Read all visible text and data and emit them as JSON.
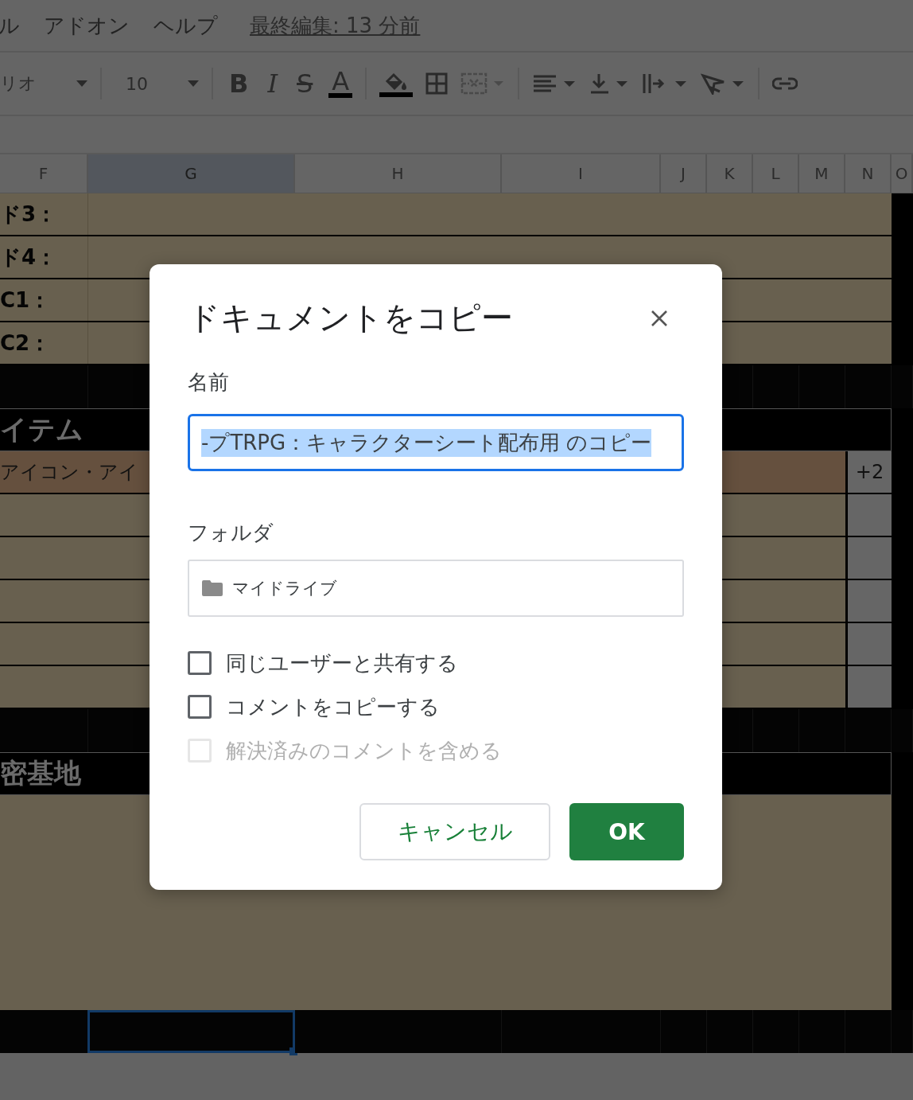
{
  "menu": {
    "items": [
      "ル",
      "アドオン",
      "ヘルプ"
    ],
    "last_edit": "最終編集: 13 分前"
  },
  "toolbar": {
    "font": "リオ",
    "font_size": "10",
    "format_buttons": [
      {
        "kind": "bold",
        "label": "B"
      },
      {
        "kind": "italic",
        "label": "I"
      },
      {
        "kind": "strike",
        "label": "S"
      },
      {
        "kind": "color",
        "label": "A"
      }
    ]
  },
  "columns": [
    {
      "label": "F",
      "selected": false
    },
    {
      "label": "G",
      "selected": true
    },
    {
      "label": "H",
      "selected": false
    },
    {
      "label": "I",
      "selected": false
    },
    {
      "label": "J",
      "selected": false
    },
    {
      "label": "K",
      "selected": false
    },
    {
      "label": "L",
      "selected": false
    },
    {
      "label": "M",
      "selected": false
    },
    {
      "label": "N",
      "selected": false
    },
    {
      "label": "O",
      "selected": false
    }
  ],
  "rows": [
    {
      "kind": "label",
      "text": "ド3："
    },
    {
      "kind": "label",
      "text": "ド4："
    },
    {
      "kind": "label",
      "text": "C1："
    },
    {
      "kind": "label",
      "text": "C2："
    },
    {
      "kind": "dark"
    },
    {
      "kind": "heading",
      "text": "イテム"
    },
    {
      "kind": "item",
      "text": "アイコン・アイ",
      "value": "+2"
    },
    {
      "kind": "blank"
    },
    {
      "kind": "blank"
    },
    {
      "kind": "blank"
    },
    {
      "kind": "blank"
    },
    {
      "kind": "blank"
    },
    {
      "kind": "dark"
    },
    {
      "kind": "heading",
      "text": "密基地"
    },
    {
      "kind": "tall"
    },
    {
      "kind": "dark",
      "cell_selected": true
    }
  ],
  "dialog": {
    "title": "ドキュメントをコピー",
    "name_label": "名前",
    "name_value": "-プTRPG：キャラクターシート配布用 のコピー",
    "name_text_selected": true,
    "folder_label": "フォルダ",
    "folder_value": "マイドライブ",
    "options": [
      {
        "label": "同じユーザーと共有する",
        "checked": false,
        "disabled": false
      },
      {
        "label": "コメントをコピーする",
        "checked": false,
        "disabled": false
      },
      {
        "label": "解決済みのコメントを含める",
        "checked": false,
        "disabled": true
      }
    ],
    "buttons": [
      {
        "kind": "secondary",
        "label": "キャンセル"
      },
      {
        "kind": "primary",
        "label": "OK"
      }
    ]
  }
}
